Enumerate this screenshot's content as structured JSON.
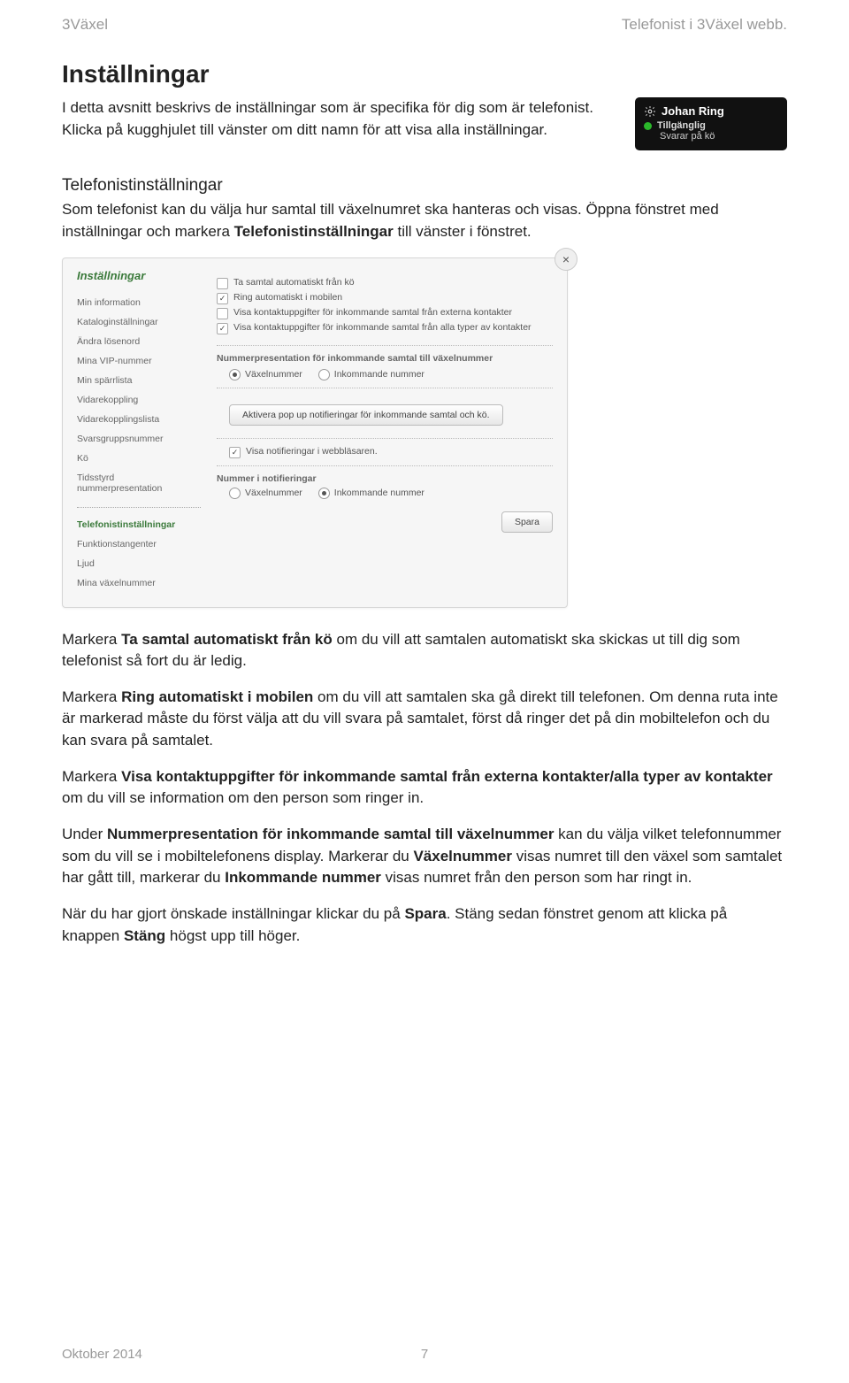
{
  "header": {
    "left": "3Växel",
    "right": "Telefonist i 3Växel webb."
  },
  "section_title": "Inställningar",
  "intro_p1": "I detta avsnitt beskrivs de inställningar som är specifika för dig som är telefonist. Klicka på kugghjulet till vänster om ditt namn för att visa alla inställningar.",
  "user_widget": {
    "name": "Johan Ring",
    "status": "Tillgänglig",
    "sub": "Svarar på kö"
  },
  "sub_title": "Telefonistinställningar",
  "intro_p2_a": "Som telefonist kan du välja hur samtal till växelnumret ska hanteras och visas. Öppna fönstret med inställningar och markera ",
  "intro_p2_bold": "Telefonistinställningar",
  "intro_p2_b": " till vänster i fönstret.",
  "panel": {
    "title": "Inställningar",
    "sidebar_top": [
      "Min information",
      "Kataloginställningar",
      "Ändra lösenord",
      "Mina VIP-nummer",
      "Min spärrlista",
      "Vidarekoppling",
      "Vidarekopplingslista",
      "Svarsgruppsnummer",
      "Kö",
      "Tidsstyrd nummerpresentation"
    ],
    "sidebar_bottom": [
      "Telefonistinställningar",
      "Funktionstangenter",
      "Ljud",
      "Mina växelnummer"
    ],
    "chk1": "Ta samtal automatiskt från kö",
    "chk2": "Ring automatiskt i mobilen",
    "chk3": "Visa kontaktuppgifter för inkommande samtal från externa kontakter",
    "chk4": "Visa kontaktuppgifter för inkommande samtal från alla typer av kontakter",
    "group1": "Nummerpresentation för inkommande samtal till växelnummer",
    "r1a": "Växelnummer",
    "r1b": "Inkommande nummer",
    "btn_popup": "Aktivera pop up notifieringar för inkommande samtal och kö.",
    "chk5": "Visa notifieringar i webbläsaren.",
    "group2": "Nummer i notifieringar",
    "r2a": "Växelnummer",
    "r2b": "Inkommande nummer",
    "save": "Spara"
  },
  "p_after_1a": "Markera ",
  "p_after_1bold": "Ta samtal automatiskt från kö",
  "p_after_1b": " om du vill att samtalen automatiskt ska skickas ut till dig som telefonist så fort du är ledig.",
  "p_after_2a": "Markera ",
  "p_after_2bold": "Ring automatiskt i mobilen",
  "p_after_2b": " om du vill att samtalen ska gå direkt till telefonen. Om denna ruta inte är markerad måste du först välja att du vill svara på samtalet, först då ringer det på din mobiltelefon och du kan svara på samtalet.",
  "p_after_3a": "Markera ",
  "p_after_3bold": "Visa kontaktuppgifter för inkommande samtal från externa kontakter/alla typer av kontakter",
  "p_after_3b": " om du vill se information om den person som ringer in.",
  "p_after_4a": "Under ",
  "p_after_4bold1": "Nummerpresentation för inkommande samtal till växelnummer",
  "p_after_4b": " kan du välja vilket telefonnummer som du vill se i mobiltelefonens display. Markerar du ",
  "p_after_4bold2": "Växelnummer",
  "p_after_4c": " visas numret till den växel som samtalet har gått till, markerar du ",
  "p_after_4bold3": "Inkommande nummer",
  "p_after_4d": " visas numret från den person som har ringt in.",
  "p_after_5a": "När du har gjort önskade inställningar klickar du på ",
  "p_after_5bold1": "Spara",
  "p_after_5b": ". Stäng sedan fönstret genom att klicka på knappen ",
  "p_after_5bold2": "Stäng",
  "p_after_5c": " högst upp till höger.",
  "footer": {
    "left": "Oktober 2014",
    "page": "7"
  }
}
